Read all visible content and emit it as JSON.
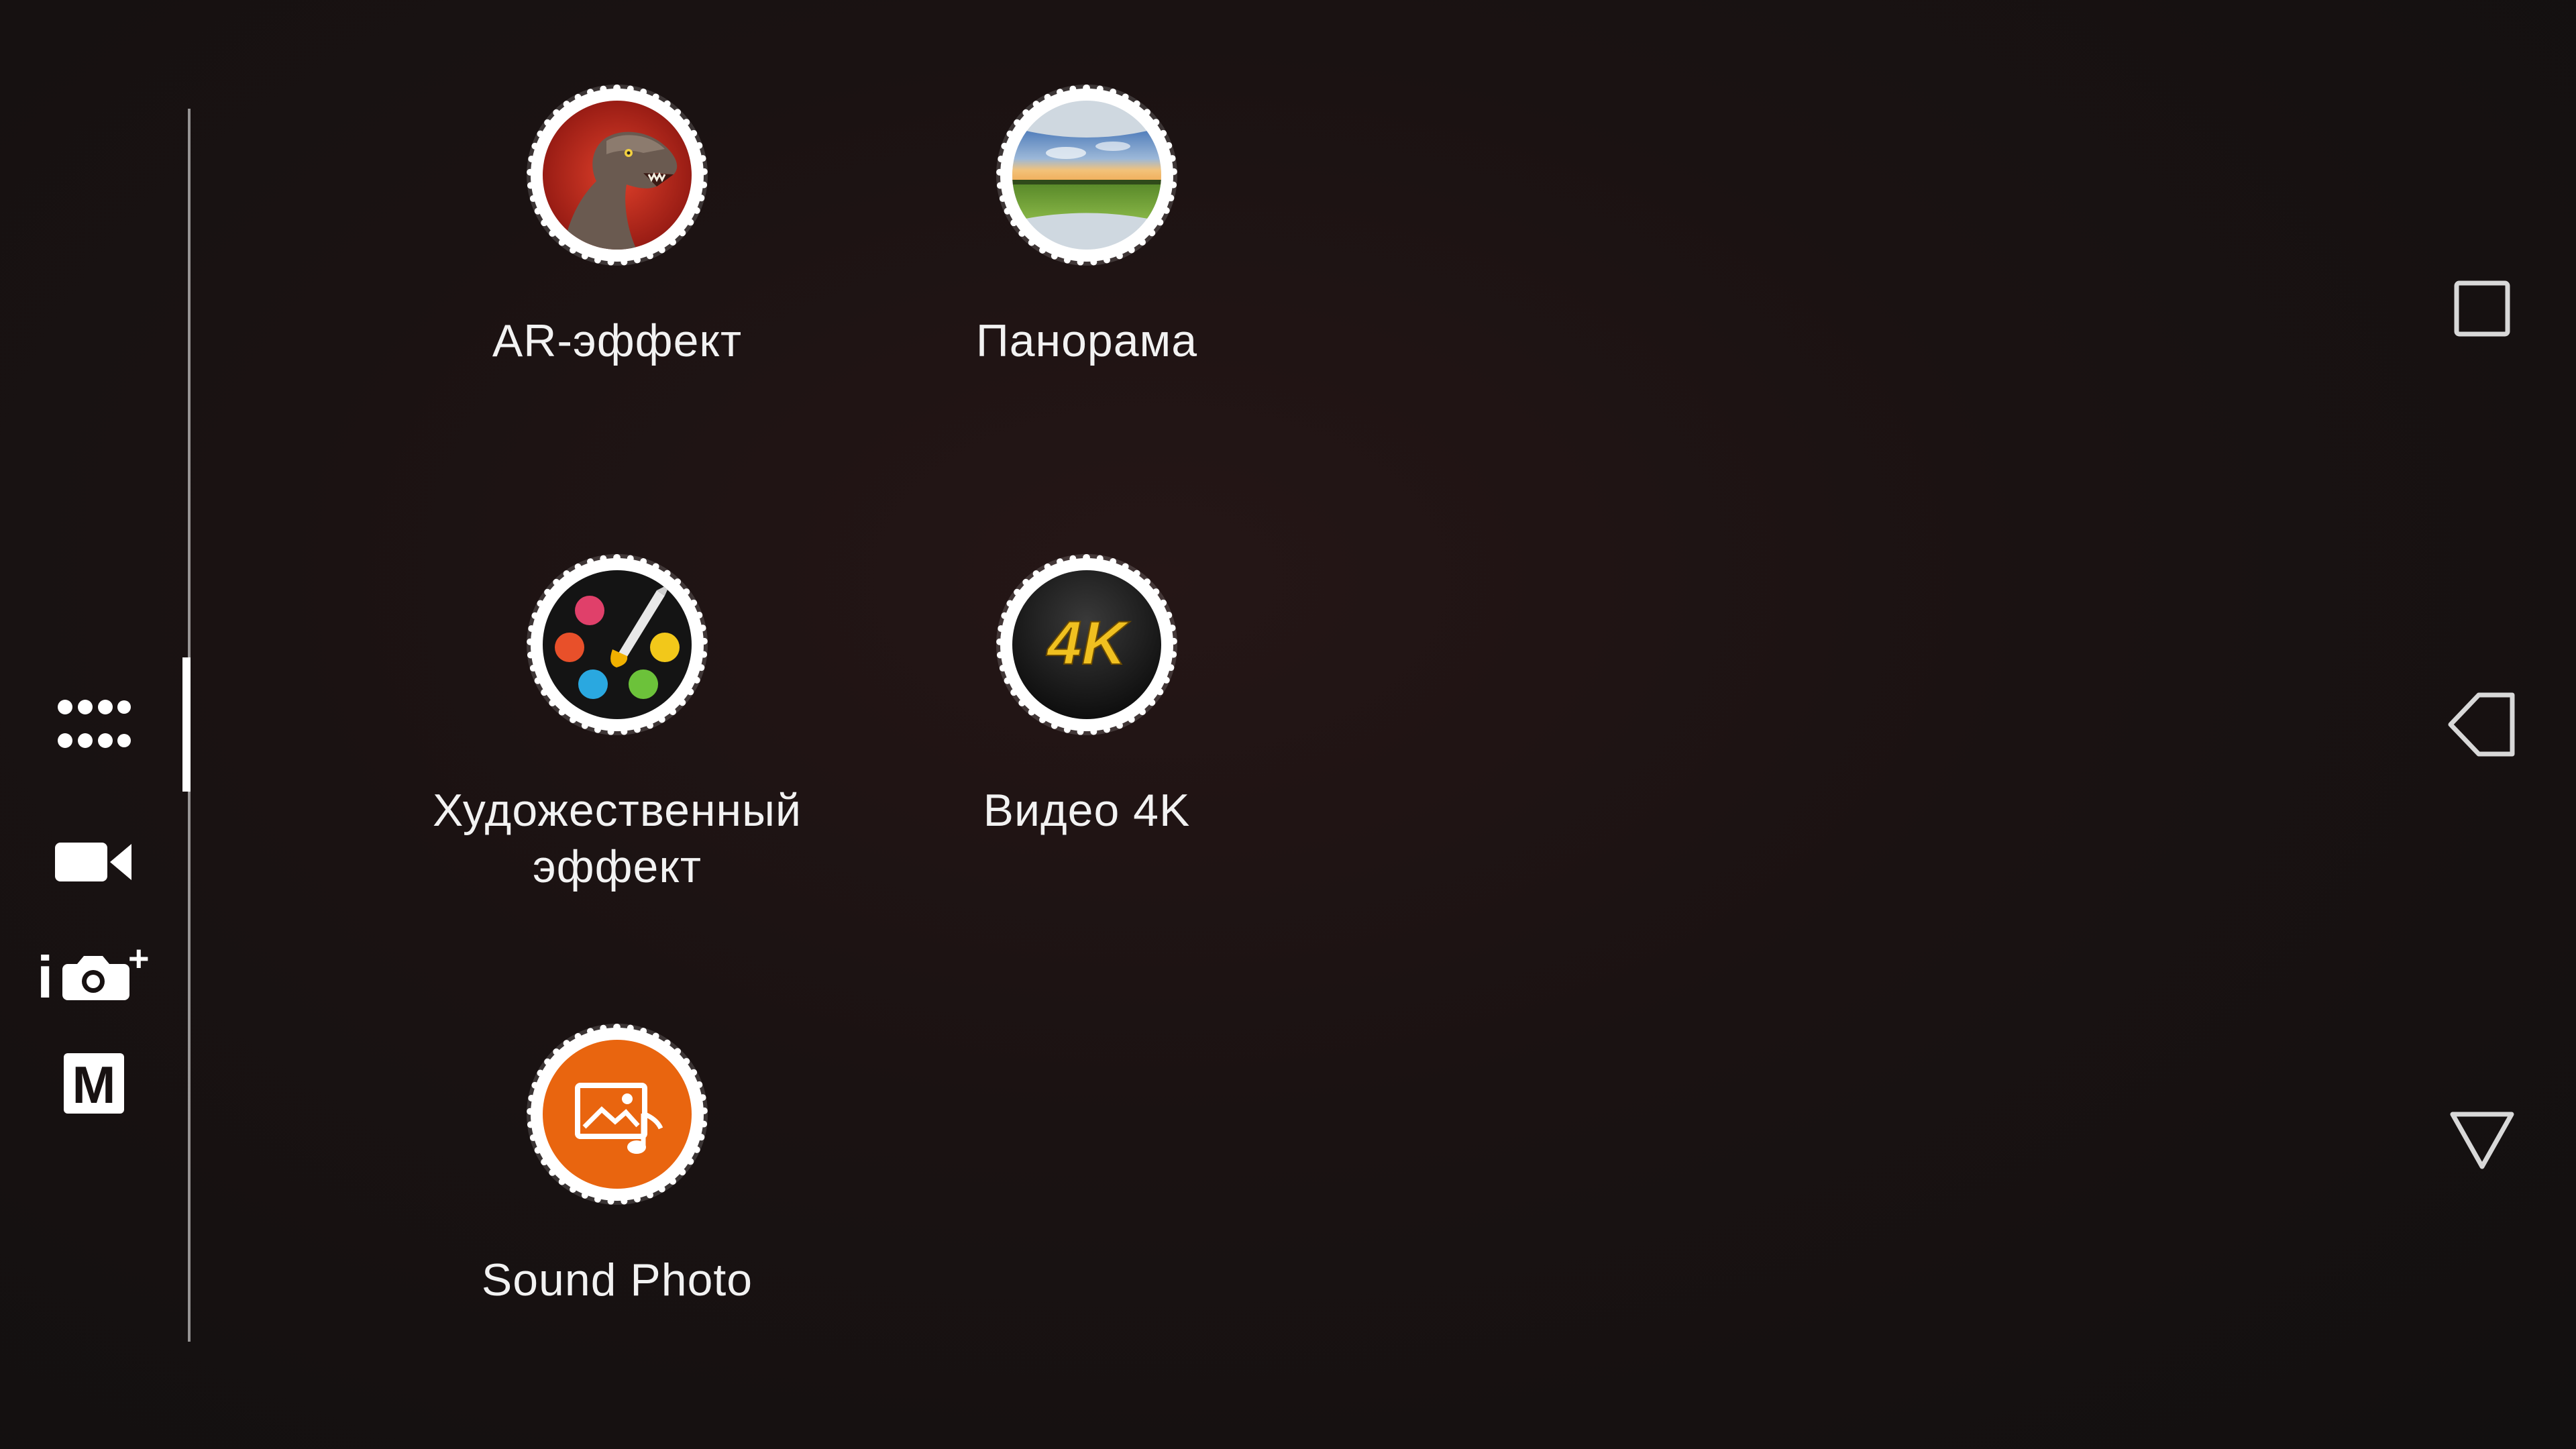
{
  "mode_rail": {
    "items": [
      {
        "id": "apps",
        "icon": "apps-grid-icon",
        "active": true
      },
      {
        "id": "video",
        "icon": "video-camera-icon",
        "active": false
      },
      {
        "id": "superior-auto",
        "icon": "camera-intelligent-plus-icon",
        "active": false,
        "glyph_i": "i",
        "glyph_plus": "+"
      },
      {
        "id": "manual",
        "icon": "manual-mode-icon",
        "active": false,
        "glyph": "M"
      }
    ]
  },
  "modes": [
    {
      "label": "AR-эффект",
      "icon": "dinosaur-ar-icon"
    },
    {
      "label": "Панорама",
      "icon": "panorama-landscape-icon"
    },
    {
      "label_line1": "Художественный",
      "label_line2": "эффект",
      "icon": "paint-palette-icon"
    },
    {
      "label": "Видео 4K",
      "icon": "video-4k-icon",
      "icon_text": "4K"
    },
    {
      "label": "Sound Photo",
      "icon": "sound-photo-icon"
    }
  ],
  "nav_bar": {
    "items": [
      {
        "id": "recents",
        "icon": "square-recents-icon"
      },
      {
        "id": "back",
        "icon": "triangle-back-icon"
      },
      {
        "id": "home",
        "icon": "triangle-down-icon"
      }
    ]
  },
  "colors": {
    "background": "#140f0f",
    "sound_photo_orange": "#e9650f",
    "video4k_gold": "#f0c020"
  }
}
